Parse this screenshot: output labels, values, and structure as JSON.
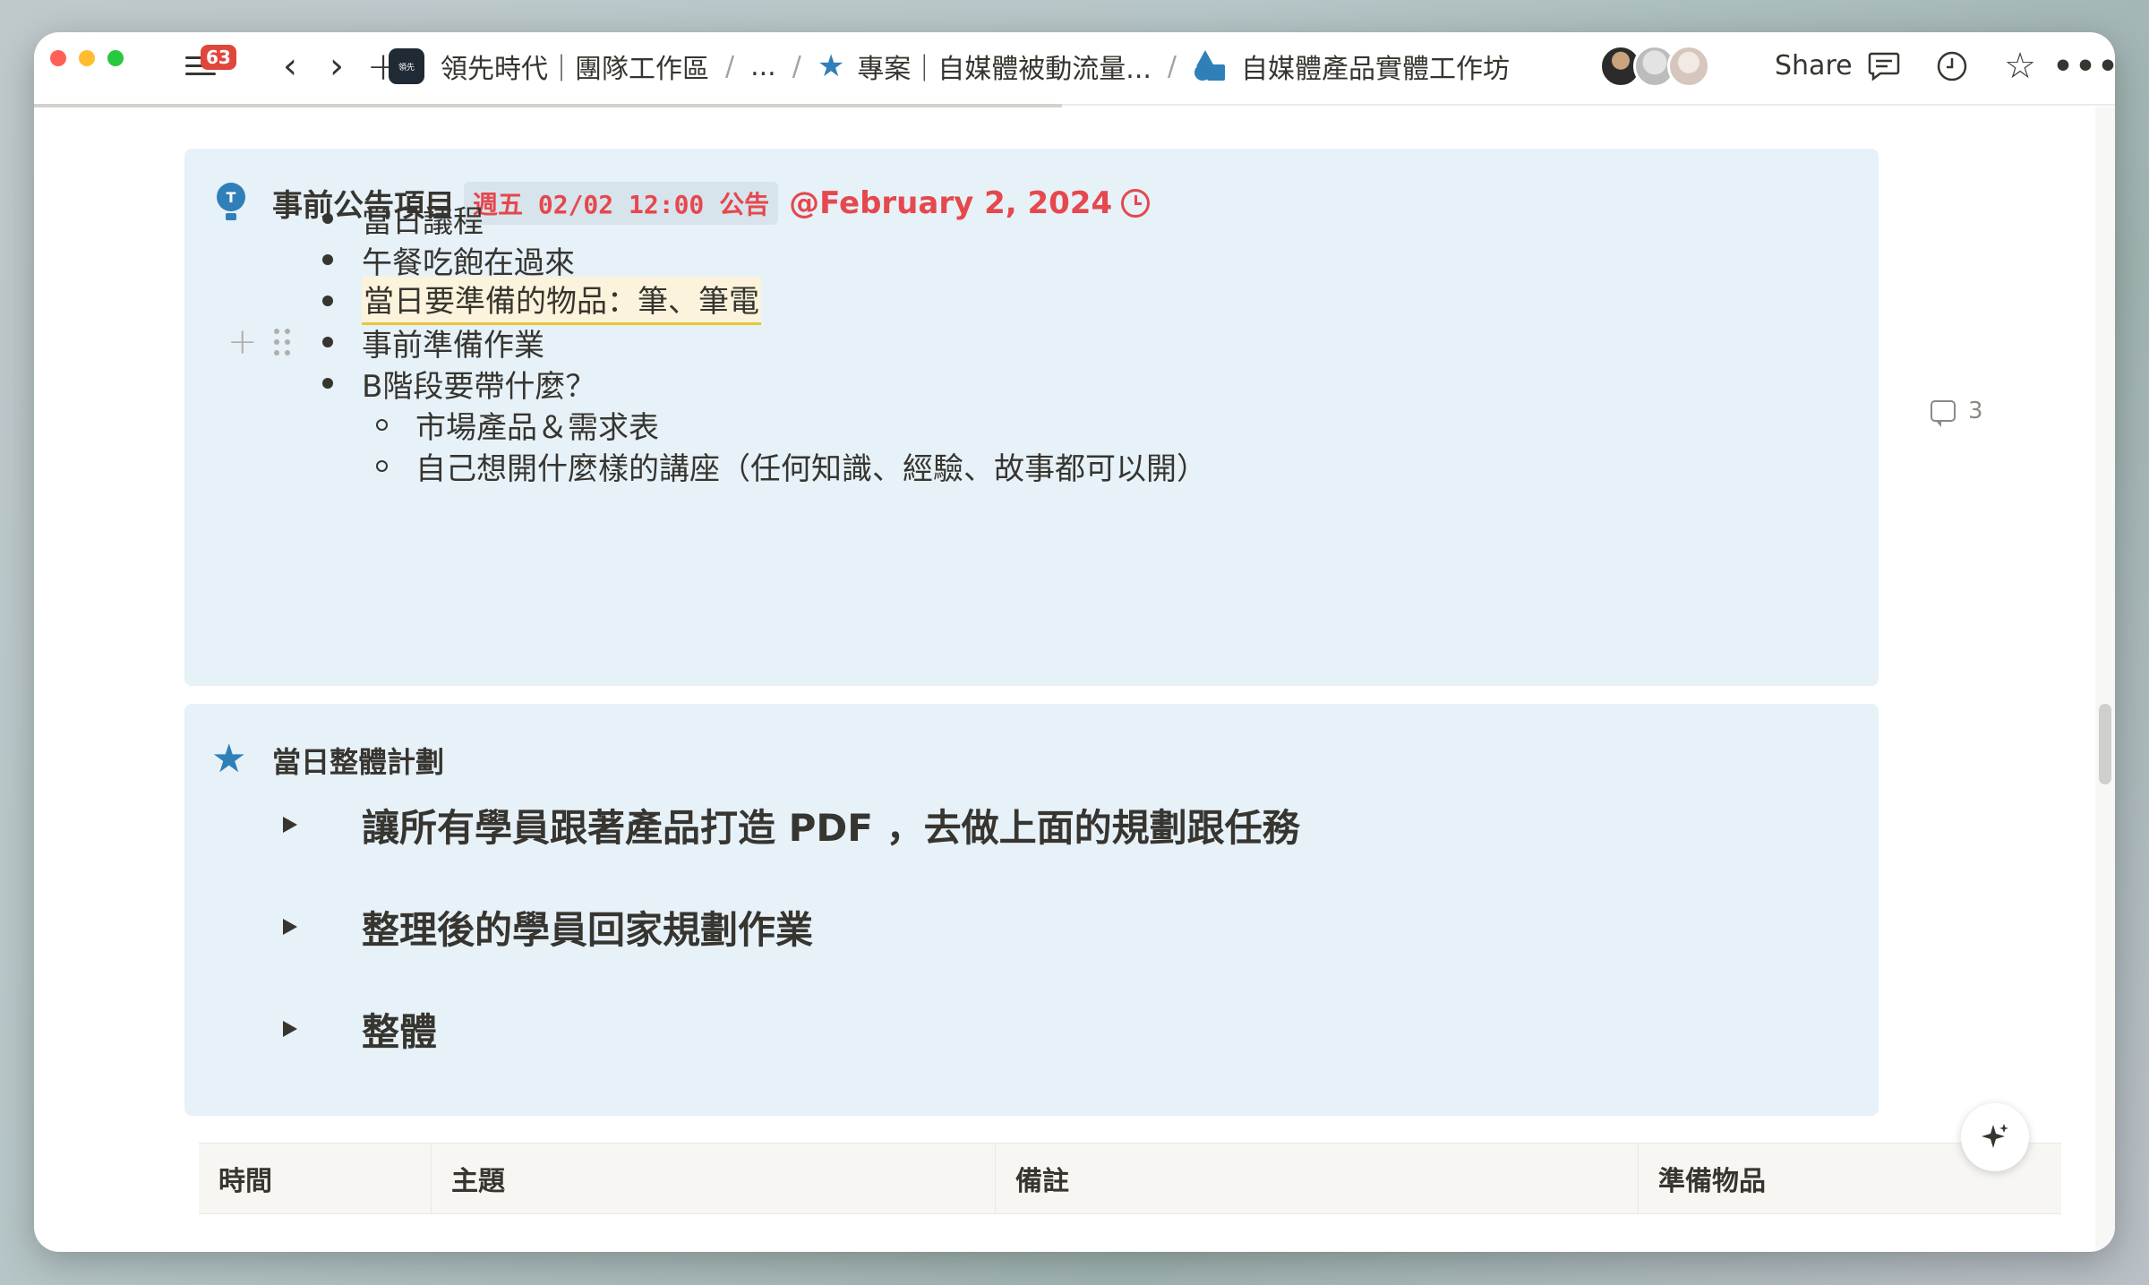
{
  "topbar": {
    "notification_count": "63",
    "breadcrumbs": [
      {
        "label": "領先時代｜團隊工作區",
        "icon": "workspace-logo-icon"
      },
      {
        "label": "..."
      },
      {
        "label": "專案｜自媒體被動流量...",
        "icon": "star-icon"
      },
      {
        "label": "自媒體產品實體工作坊",
        "icon": "shapes-icon"
      }
    ],
    "separator": "/",
    "share_label": "Share"
  },
  "callout1": {
    "title": "事前公告項目",
    "code_tag": "週五 02/02 12:00 公告",
    "mention": "@February 2, 2024",
    "bullets": [
      "當日議程",
      "午餐吃飽在過來",
      "當日要準備的物品：筆、筆電",
      "事前準備作業",
      "B階段要帶什麼？"
    ],
    "sub_bullets": [
      "市場產品＆需求表",
      "自己想開什麼樣的講座（任何知識、經驗、故事都可以開）"
    ],
    "comment_count": "3"
  },
  "callout2": {
    "title": "當日整體計劃",
    "toggles": [
      "讓所有學員跟著產品打造 PDF ，去做上面的規劃跟任務",
      "整理後的學員回家規劃作業",
      "整體"
    ]
  },
  "table": {
    "headers": [
      "時間",
      "主題",
      "備註",
      "準備物品"
    ]
  },
  "colors": {
    "callout_bg": "#e7f1f8",
    "accent_blue": "#2f7fb8",
    "mention_red": "#e5484d",
    "text": "#37352f"
  }
}
